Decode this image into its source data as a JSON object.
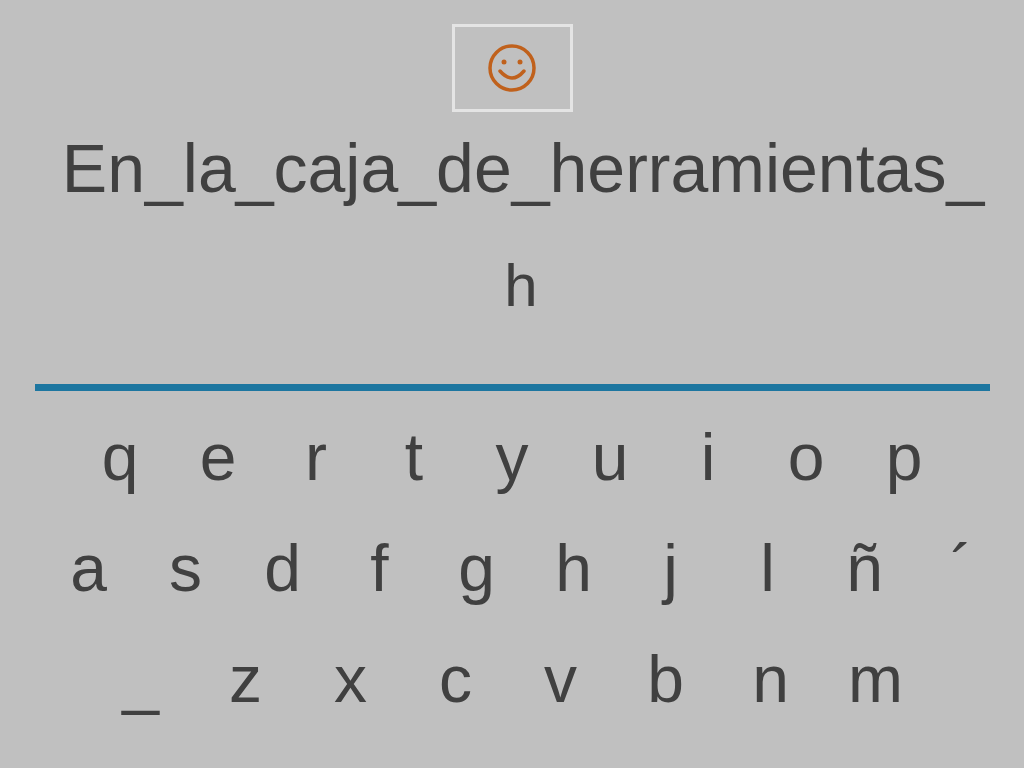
{
  "sentence": "En_la_caja_de_herramientas_",
  "answer": "h",
  "keyboard": {
    "rows": [
      [
        "q",
        "e",
        "r",
        "t",
        "y",
        "u",
        "i",
        "o",
        "p"
      ],
      [
        "a",
        "s",
        "d",
        "f",
        "g",
        "h",
        "j",
        "l",
        "ñ",
        "´"
      ],
      [
        "_",
        "z",
        "x",
        "c",
        "v",
        "b",
        "n",
        "m"
      ]
    ]
  }
}
